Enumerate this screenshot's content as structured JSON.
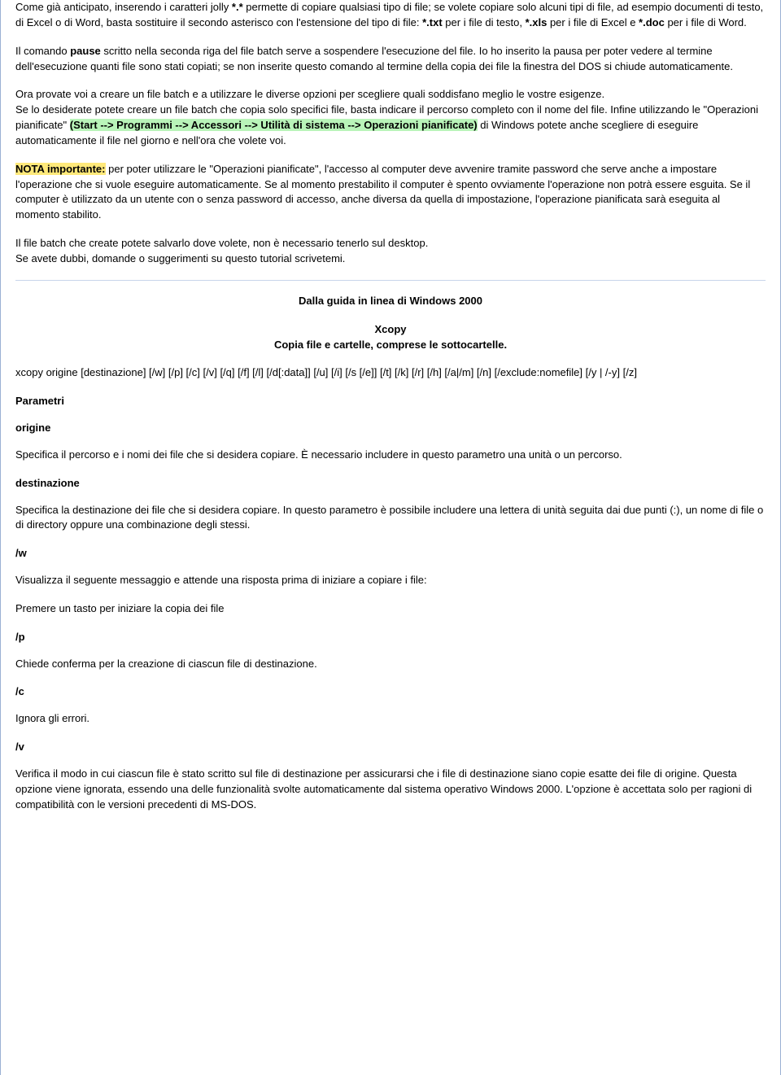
{
  "intro": {
    "p1_a": "Come già anticipato, inserendo i caratteri jolly ",
    "p1_b": "*.*",
    "p1_c": " permette di copiare qualsiasi tipo di file; se volete copiare solo alcuni tipi di file, ad esempio documenti di testo, di Excel o di Word, basta sostituire il secondo asterisco con l'estensione del tipo di file: ",
    "p1_d": "*.txt",
    "p1_e": " per i file di testo, ",
    "p1_f": "*.xls",
    "p1_g": " per i file di Excel e ",
    "p1_h": "*.doc",
    "p1_i": " per i file di Word.",
    "p2_a": "Il comando ",
    "p2_b": "pause",
    "p2_c": " scritto nella seconda riga del file batch serve a sospendere l'esecuzione del file. Io ho inserito la pausa per poter vedere al termine dell'esecuzione quanti file sono stati copiati; se non inserite questo comando al termine della copia dei file la finestra del DOS si chiude automaticamente.",
    "p3_a": "Ora provate voi a creare un file batch e a utilizzare le diverse opzioni per scegliere quali soddisfano meglio le vostre esigenze.",
    "p3_b": "Se lo desiderate potete creare un file batch che copia solo specifici file, basta indicare il percorso completo con il nome del file. Infine utilizzando le \"Operazioni pianificate\" ",
    "p3_c": "(Start --> Programmi --> Accessori --> Utilità di sistema --> Operazioni pianificate)",
    "p3_d": " di Windows potete anche scegliere di eseguire automaticamente il file nel giorno e nell'ora che volete voi.",
    "p4_a": "NOTA importante:",
    "p4_b": " per poter utilizzare le \"Operazioni pianificate\", l'accesso al computer deve avvenire tramite password che serve anche a impostare l'operazione che si vuole eseguire automaticamente. Se al momento prestabilito il computer è spento ovviamente l'operazione non potrà essere esguita. Se il computer è utilizzato da un utente con o senza password di accesso, anche diversa da quella di impostazione, l'operazione pianificata sarà eseguita al momento stabilito.",
    "p5_a": "Il file batch che create potete salvarlo dove volete, non è necessario tenerlo sul desktop.",
    "p5_b": "Se avete dubbi, domande o suggerimenti su questo tutorial scrivetemi."
  },
  "guide": {
    "heading": "Dalla guida in linea di Windows 2000",
    "title": "Xcopy",
    "subtitle": "Copia file e cartelle, comprese le sottocartelle.",
    "syntax": "xcopy origine [destinazione] [/w] [/p] [/c] [/v] [/q] [/f] [/l] [/d[:data]] [/u] [/i] [/s [/e]] [/t] [/k] [/r] [/h] [/a|/m] [/n] [/exclude:nomefile] [/y | /-y] [/z]",
    "params_label": "Parametri",
    "params": {
      "origine": {
        "name": "origine",
        "desc": "Specifica il percorso e i nomi dei file che si desidera copiare. È necessario includere in questo parametro una unità o un percorso."
      },
      "destinazione": {
        "name": "destinazione",
        "desc": "Specifica la destinazione dei file che si desidera copiare. In questo parametro è possibile includere una lettera di unità seguita dai due punti (:), un nome di file o di directory oppure una combinazione degli stessi."
      },
      "w": {
        "name": "/w",
        "desc1": "Visualizza il seguente messaggio e attende una risposta prima di iniziare a copiare i file:",
        "desc2": "Premere un tasto per iniziare la copia dei file"
      },
      "p": {
        "name": "/p",
        "desc": "Chiede conferma per la creazione di ciascun file di destinazione."
      },
      "c": {
        "name": "/c",
        "desc": "Ignora gli errori."
      },
      "v": {
        "name": "/v",
        "desc": "Verifica il modo in cui ciascun file è stato scritto sul file di destinazione per assicurarsi che i file di destinazione siano copie esatte dei file di origine. Questa opzione viene ignorata, essendo una delle funzionalità svolte automaticamente dal sistema operativo Windows 2000. L'opzione è accettata solo per ragioni di compatibilità con le versioni precedenti di MS-DOS."
      }
    }
  }
}
